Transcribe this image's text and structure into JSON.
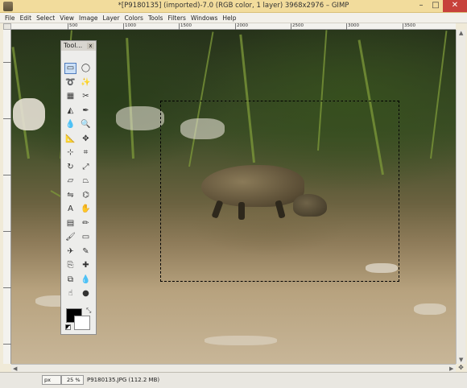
{
  "window": {
    "title": "*[P9180135] (imported)-7.0 (RGB color, 1 layer) 3968x2976 – GIMP",
    "controls": {
      "minimize": "–",
      "maximize": "□",
      "close": "✕"
    }
  },
  "menu": [
    "File",
    "Edit",
    "Select",
    "View",
    "Image",
    "Layer",
    "Colors",
    "Tools",
    "Filters",
    "Windows",
    "Help"
  ],
  "ruler": {
    "ticks": [
      "500",
      "1000",
      "1500",
      "2000",
      "2500",
      "3000",
      "3500"
    ]
  },
  "toolbox": {
    "title": "Tool...",
    "close": "x",
    "tools": [
      {
        "name": "rect-select-tool",
        "glyph": "▭"
      },
      {
        "name": "ellipse-select-tool",
        "glyph": "◯"
      },
      {
        "name": "free-select-tool",
        "glyph": "➰"
      },
      {
        "name": "fuzzy-select-tool",
        "glyph": "✨"
      },
      {
        "name": "select-by-color-tool",
        "glyph": "▦"
      },
      {
        "name": "scissors-select-tool",
        "glyph": "✂"
      },
      {
        "name": "foreground-select-tool",
        "glyph": "◭"
      },
      {
        "name": "paths-tool",
        "glyph": "✒"
      },
      {
        "name": "color-picker-tool",
        "glyph": "💧"
      },
      {
        "name": "zoom-tool",
        "glyph": "🔍"
      },
      {
        "name": "measure-tool",
        "glyph": "📐"
      },
      {
        "name": "move-tool",
        "glyph": "✥"
      },
      {
        "name": "align-tool",
        "glyph": "⊹"
      },
      {
        "name": "crop-tool",
        "glyph": "⌗"
      },
      {
        "name": "rotate-tool",
        "glyph": "↻"
      },
      {
        "name": "scale-tool",
        "glyph": "⤢"
      },
      {
        "name": "shear-tool",
        "glyph": "▱"
      },
      {
        "name": "perspective-tool",
        "glyph": "⏢"
      },
      {
        "name": "flip-tool",
        "glyph": "⇋"
      },
      {
        "name": "cage-transform-tool",
        "glyph": "⌬"
      },
      {
        "name": "text-tool",
        "glyph": "A"
      },
      {
        "name": "warp-transform-tool",
        "glyph": "✋"
      },
      {
        "name": "blend-tool",
        "glyph": "▤"
      },
      {
        "name": "pencil-tool",
        "glyph": "✏"
      },
      {
        "name": "paintbrush-tool",
        "glyph": "🖌"
      },
      {
        "name": "eraser-tool",
        "glyph": "▭"
      },
      {
        "name": "airbrush-tool",
        "glyph": "✈"
      },
      {
        "name": "ink-tool",
        "glyph": "✎"
      },
      {
        "name": "clone-tool",
        "glyph": "⎘"
      },
      {
        "name": "heal-tool",
        "glyph": "✚"
      },
      {
        "name": "perspective-clone-tool",
        "glyph": "⧉"
      },
      {
        "name": "blur-sharpen-tool",
        "glyph": "💧"
      },
      {
        "name": "smudge-tool",
        "glyph": "☝"
      },
      {
        "name": "dodge-burn-tool",
        "glyph": "●"
      }
    ]
  },
  "status": {
    "unit": "px",
    "zoom": "25 %",
    "file": "P9180135.JPG (112.2 MB)"
  }
}
